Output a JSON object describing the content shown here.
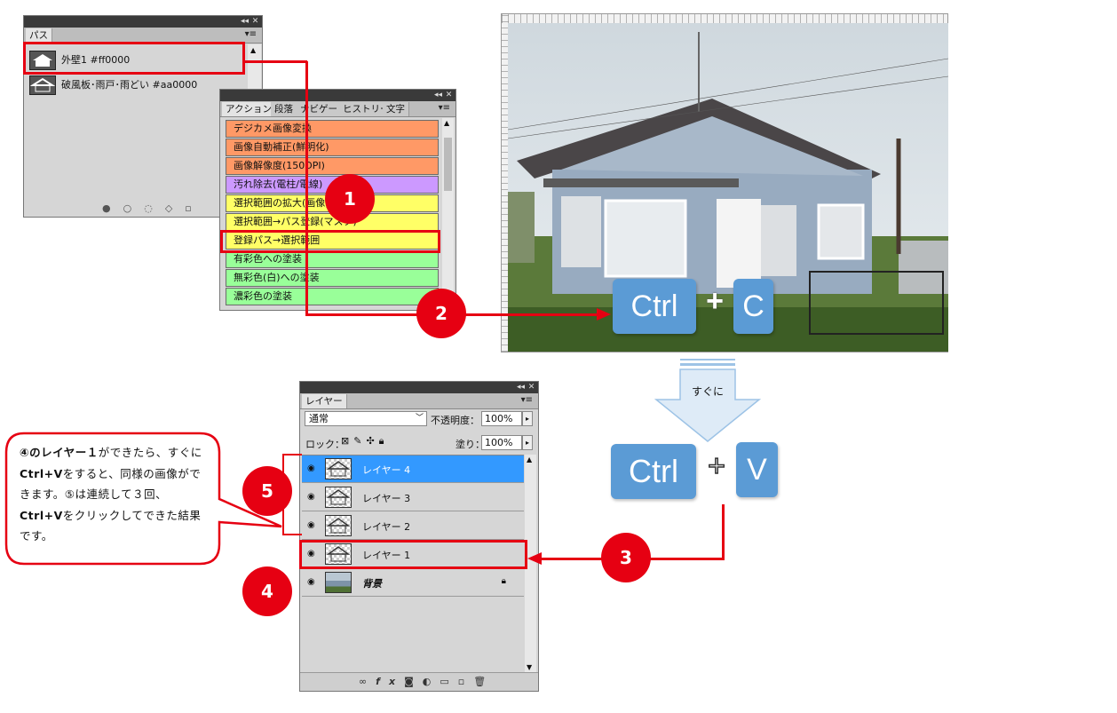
{
  "paths_panel": {
    "tab": "パス",
    "items": [
      {
        "label": "外壁1 #ff0000"
      },
      {
        "label": "破風板･雨戸･雨どい #aa0000"
      }
    ]
  },
  "actions_panel": {
    "tabs": [
      "アクション",
      "段落",
      "ナビゲー",
      "ヒストリー",
      "文字"
    ],
    "items": [
      {
        "label": "デジカメ画像変換",
        "color": "#ff9966"
      },
      {
        "label": "画像自動補正(鮮明化)",
        "color": "#ff9966"
      },
      {
        "label": "画像解像度(150DPI)",
        "color": "#ff9966"
      },
      {
        "label": "汚れ除去(電柱/電線)",
        "color": "#cc99ff"
      },
      {
        "label": "選択範囲の拡大(画像)",
        "color": "#ffff66"
      },
      {
        "label": "選択範囲→パス登録(マスク)",
        "color": "#ffff66"
      },
      {
        "label": "登録パス→選択範囲",
        "color": "#ffff66"
      },
      {
        "label": "有彩色への塗装",
        "color": "#99ff99"
      },
      {
        "label": "無彩色(白)への塗装",
        "color": "#99ff99"
      },
      {
        "label": "濃彩色の塗装",
        "color": "#99ff99"
      }
    ]
  },
  "badges": {
    "b1": "1",
    "b2": "2",
    "b3": "3",
    "b4": "4",
    "b5": "5"
  },
  "keys": {
    "ctrl": "Ctrl",
    "plus": "+",
    "c": "C",
    "v": "V"
  },
  "arrow_label": "すぐに",
  "layers_panel": {
    "tab": "レイヤー",
    "blend_mode": "通常",
    "opacity_label": "不透明度：",
    "opacity_value": "100%",
    "lock_label": "ロック：",
    "fill_label": "塗り：",
    "fill_value": "100%",
    "layers": [
      {
        "name": "レイヤー 4",
        "selected": true
      },
      {
        "name": "レイヤー 3",
        "selected": false
      },
      {
        "name": "レイヤー 2",
        "selected": false
      },
      {
        "name": "レイヤー 1",
        "selected": false
      },
      {
        "name": "背景",
        "selected": false
      }
    ]
  },
  "callout": {
    "text_html_parts": [
      {
        "t": "④のレイヤー１",
        "bold": true
      },
      {
        "t": "ができたら、すぐに",
        "bold": false
      },
      {
        "t": "Ctrl+V",
        "bold": true
      },
      {
        "t": "をすると、同様の画像ができます。⑤は連続して３回、",
        "bold": false
      },
      {
        "t": "Ctrl+V",
        "bold": true
      },
      {
        "t": "をクリックしてできた結果です。",
        "bold": false
      }
    ]
  },
  "colors": {
    "accent_red": "#e60012",
    "key_blue": "#5b9bd5",
    "selected_layer": "#3399ff"
  }
}
